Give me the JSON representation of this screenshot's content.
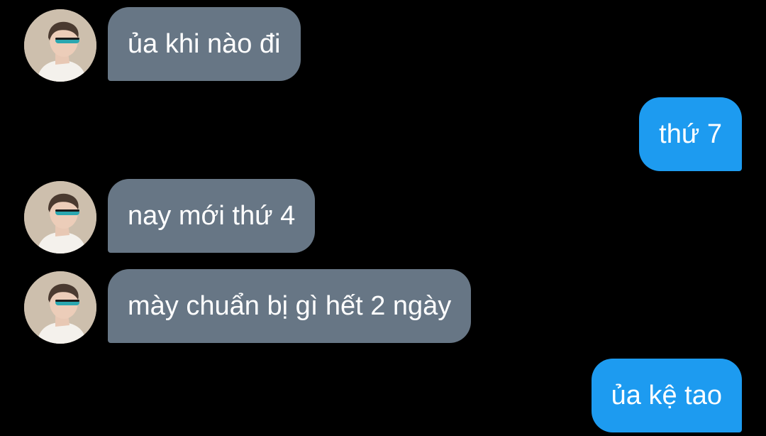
{
  "conversation": {
    "messages": [
      {
        "direction": "incoming",
        "text": "ủa khi nào đi"
      },
      {
        "direction": "outgoing",
        "text": "thứ 7"
      },
      {
        "direction": "incoming",
        "text": "nay mới thứ 4"
      },
      {
        "direction": "incoming",
        "text": "mày chuẩn bị gì hết 2 ngày"
      },
      {
        "direction": "outgoing",
        "text": "ủa kệ tao"
      }
    ]
  },
  "colors": {
    "background": "#000000",
    "incoming_bubble": "#677685",
    "outgoing_bubble": "#1d9bf0",
    "text": "#ffffff"
  },
  "icons": {
    "contact_avatar": "avatar-person-sunglasses"
  }
}
